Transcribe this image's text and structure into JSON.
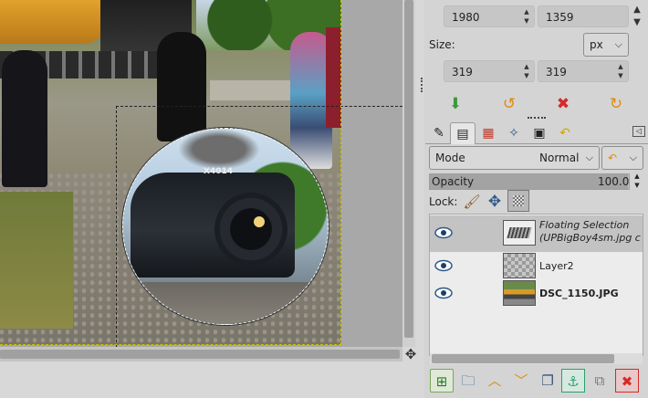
{
  "image_window": {
    "float_label": "X4014"
  },
  "size_panel": {
    "width_px": "1980",
    "height_px": "1359",
    "size_label": "Size:",
    "unit": "px",
    "layer_width": "319",
    "layer_height": "319"
  },
  "tool_options_buttons": [
    "save-preset-icon",
    "reset-icon",
    "delete-icon",
    "restore-icon"
  ],
  "dock_tabs": [
    "tool-options-icon",
    "layers-icon",
    "channels-icon",
    "paths-icon",
    "images-icon",
    "undo-icon"
  ],
  "layers_panel": {
    "mode_label": "Mode",
    "mode_value": "Normal",
    "opacity_label": "Opacity",
    "opacity_value": "100.0",
    "lock_label": "Lock:",
    "layers": [
      {
        "name": "Floating Selection",
        "sub": "(UPBigBoy4sm.jpg c",
        "italic": true,
        "selected": true
      },
      {
        "name": "Layer2",
        "sub": "",
        "italic": false,
        "selected": false
      },
      {
        "name": "DSC_1150.JPG",
        "sub": "",
        "italic": false,
        "selected": false,
        "bold": true
      }
    ]
  },
  "layer_buttons": [
    "new-layer",
    "new-layer-group",
    "raise-layer",
    "lower-layer",
    "duplicate-layer",
    "anchor-layer",
    "merge-layer",
    "delete-layer"
  ],
  "colors": {
    "selection_highlight": "#c3c3c3",
    "delete_red": "#d62a2a",
    "anchor_green": "#2aa06a"
  }
}
